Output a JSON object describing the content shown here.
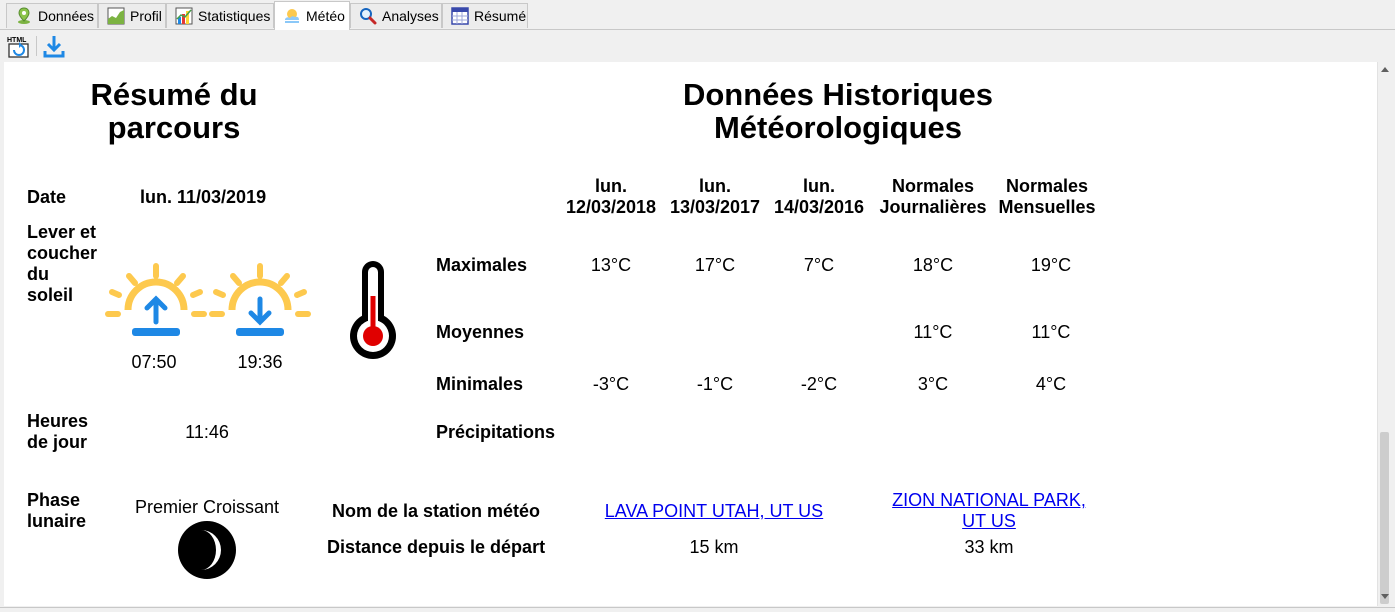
{
  "tabs": [
    {
      "label": "Données",
      "icon": "map-pin-icon"
    },
    {
      "label": "Profil",
      "icon": "profile-chart-icon"
    },
    {
      "label": "Statistiques",
      "icon": "statistics-chart-icon"
    },
    {
      "label": "Météo",
      "icon": "weather-icon",
      "active": true
    },
    {
      "label": "Analyses",
      "icon": "magnifier-icon"
    },
    {
      "label": "Résumé",
      "icon": "calendar-table-icon"
    }
  ],
  "toolbar": {
    "html_badge": "HTML",
    "export_icon": "html-export-icon",
    "download_icon": "download-icon"
  },
  "summary": {
    "title_line1": "Résumé du",
    "title_line2": "parcours",
    "date_label": "Date",
    "date_value": "lun. 11/03/2019",
    "sun_label": [
      "Lever et",
      "coucher",
      "du",
      "soleil"
    ],
    "sunrise_time": "07:50",
    "sunset_time": "19:36",
    "daylight_label": [
      "Heures",
      "de jour"
    ],
    "daylight_value": "11:46",
    "moon_label": [
      "Phase",
      "lunaire"
    ],
    "moon_value": "Premier Croissant"
  },
  "weather": {
    "title_line1": "Données Historiques",
    "title_line2": "Météorologiques",
    "columns": [
      [
        "lun.",
        "12/03/2018"
      ],
      [
        "lun.",
        "13/03/2017"
      ],
      [
        "lun.",
        "14/03/2016"
      ],
      [
        "Normales",
        "Journalières"
      ],
      [
        "Normales",
        "Mensuelles"
      ]
    ],
    "rows": [
      {
        "label": "Maximales",
        "values": [
          "13°C",
          "17°C",
          "7°C",
          "18°C",
          "19°C"
        ]
      },
      {
        "label": "Moyennes",
        "values": [
          "",
          "",
          "",
          "11°C",
          "11°C"
        ]
      },
      {
        "label": "Minimales",
        "values": [
          "-3°C",
          "-1°C",
          "-2°C",
          "3°C",
          "4°C"
        ]
      },
      {
        "label": "Précipitations",
        "values": [
          "",
          "",
          "",
          "",
          ""
        ]
      }
    ],
    "station_label": "Nom de la station météo",
    "distance_label": "Distance depuis le départ",
    "stations": [
      {
        "name_lines": [
          "LAVA POINT UTAH, UT US"
        ],
        "distance": "15 km"
      },
      {
        "name_lines": [
          "ZION NATIONAL PARK,",
          "UT US"
        ],
        "distance": "33 km"
      }
    ]
  },
  "colors": {
    "sun_yellow": "#fdc94e",
    "sun_blue": "#1e88e5",
    "thermo_red": "#e00000",
    "link": "#0000ee"
  }
}
